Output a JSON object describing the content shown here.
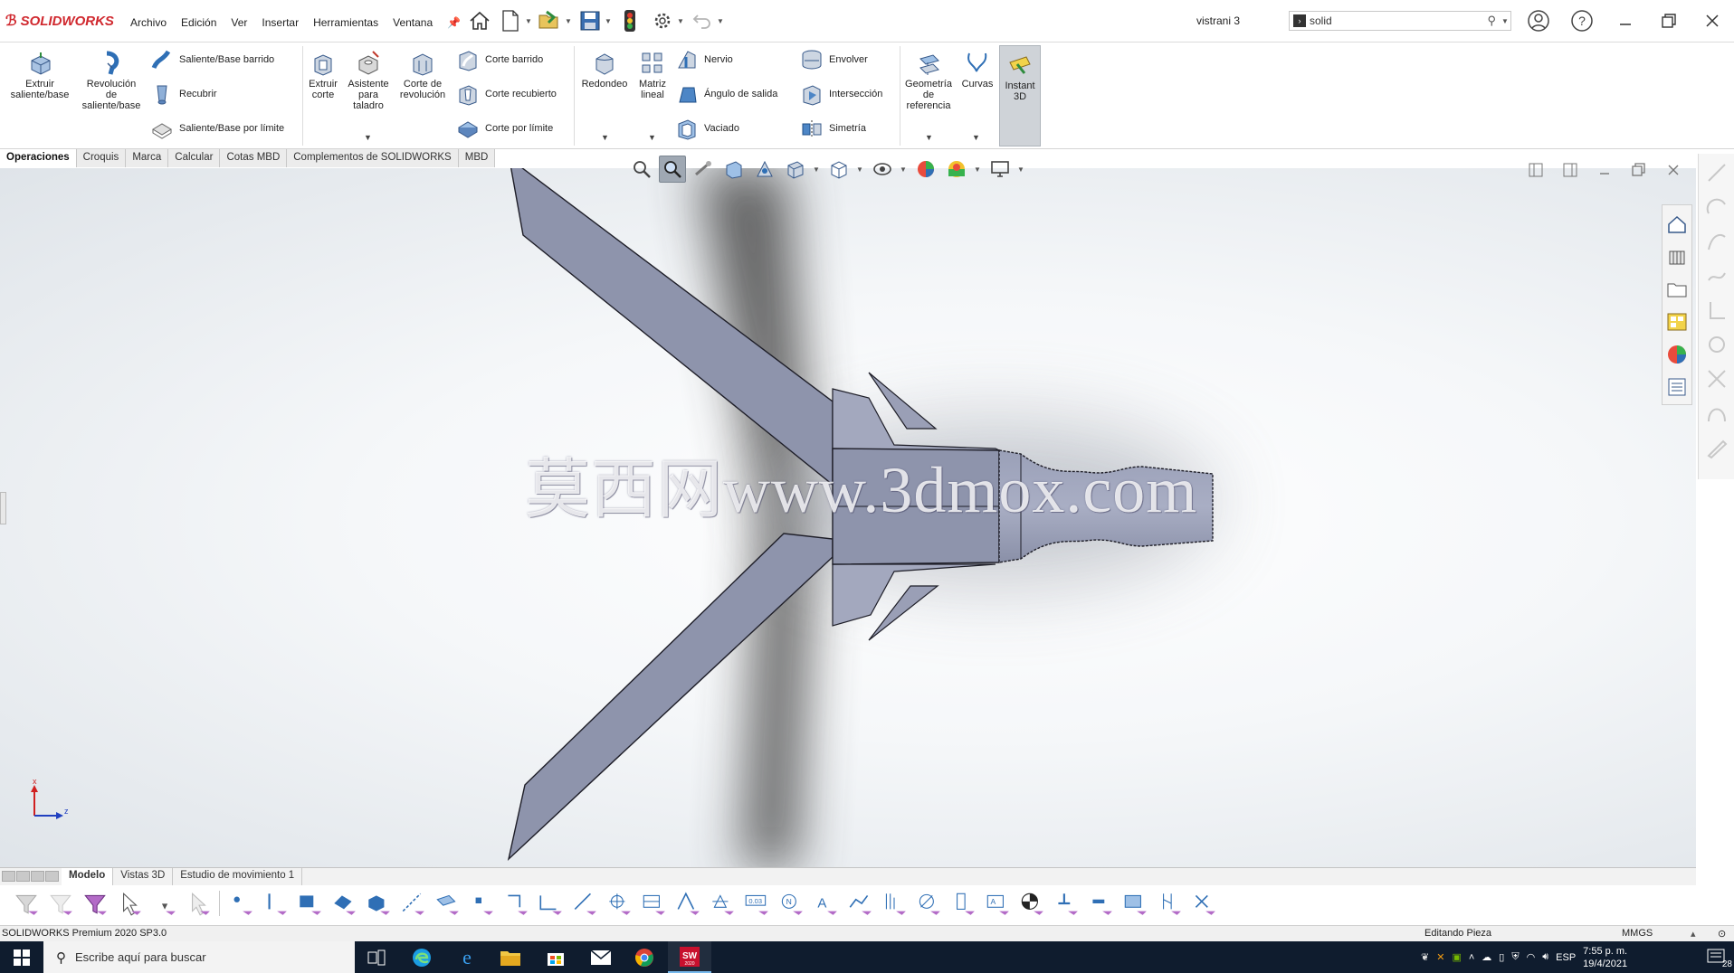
{
  "app": {
    "name": "SOLIDWORKS",
    "document_title": "vistrani 3",
    "brand_color": "#d0282e"
  },
  "menu": [
    "Archivo",
    "Edición",
    "Ver",
    "Insertar",
    "Herramientas",
    "Ventana"
  ],
  "search": {
    "value": "solid",
    "icon": "solidworks-search-icon"
  },
  "ribbon": {
    "extrude_boss": "Extruir saliente/base",
    "revolve_boss_l1": "Revolución",
    "revolve_boss_l2": "de",
    "revolve_boss_l3": "saliente/base",
    "swept_boss": "Saliente/Base barrido",
    "loft": "Recubrir",
    "boundary_boss": "Saliente/Base por límite",
    "extrude_cut_l1": "Extruir",
    "extrude_cut_l2": "corte",
    "hole_wizard_l1": "Asistente",
    "hole_wizard_l2": "para",
    "hole_wizard_l3": "taladro",
    "revolve_cut_l1": "Corte de",
    "revolve_cut_l2": "revolución",
    "swept_cut": "Corte barrido",
    "lofted_cut": "Corte recubierto",
    "boundary_cut": "Corte por límite",
    "fillet": "Redondeo",
    "linear_pattern_l1": "Matriz",
    "linear_pattern_l2": "lineal",
    "rib": "Nervio",
    "draft": "Ángulo de salida",
    "shell": "Vaciado",
    "wrap": "Envolver",
    "intersect": "Intersección",
    "mirror": "Simetría",
    "ref_geometry_l1": "Geometría",
    "ref_geometry_l2": "de",
    "ref_geometry_l3": "referencia",
    "curves": "Curvas",
    "instant3d_l1": "Instant",
    "instant3d_l2": "3D"
  },
  "tabs": [
    "Operaciones",
    "Croquis",
    "Marca",
    "Calcular",
    "Cotas MBD",
    "Complementos de SOLIDWORKS",
    "MBD"
  ],
  "active_tab": "Operaciones",
  "viewport": {
    "watermark": "莫西网www.3dmox.com",
    "model_color": "#8e94ac",
    "triad_x": "x",
    "triad_z": "z"
  },
  "bottom_tabs": [
    "Modelo",
    "Vistas 3D",
    "Estudio de movimiento 1"
  ],
  "active_bottom_tab": "Modelo",
  "status": {
    "version": "SOLIDWORKS Premium 2020 SP3.0",
    "mode": "Editando Pieza",
    "units": "MMGS"
  },
  "taskbar": {
    "search_placeholder": "Escribe aquí para buscar",
    "language": "ESP",
    "time": "7:55 p. m.",
    "date": "19/4/2021",
    "notifications": "28"
  }
}
